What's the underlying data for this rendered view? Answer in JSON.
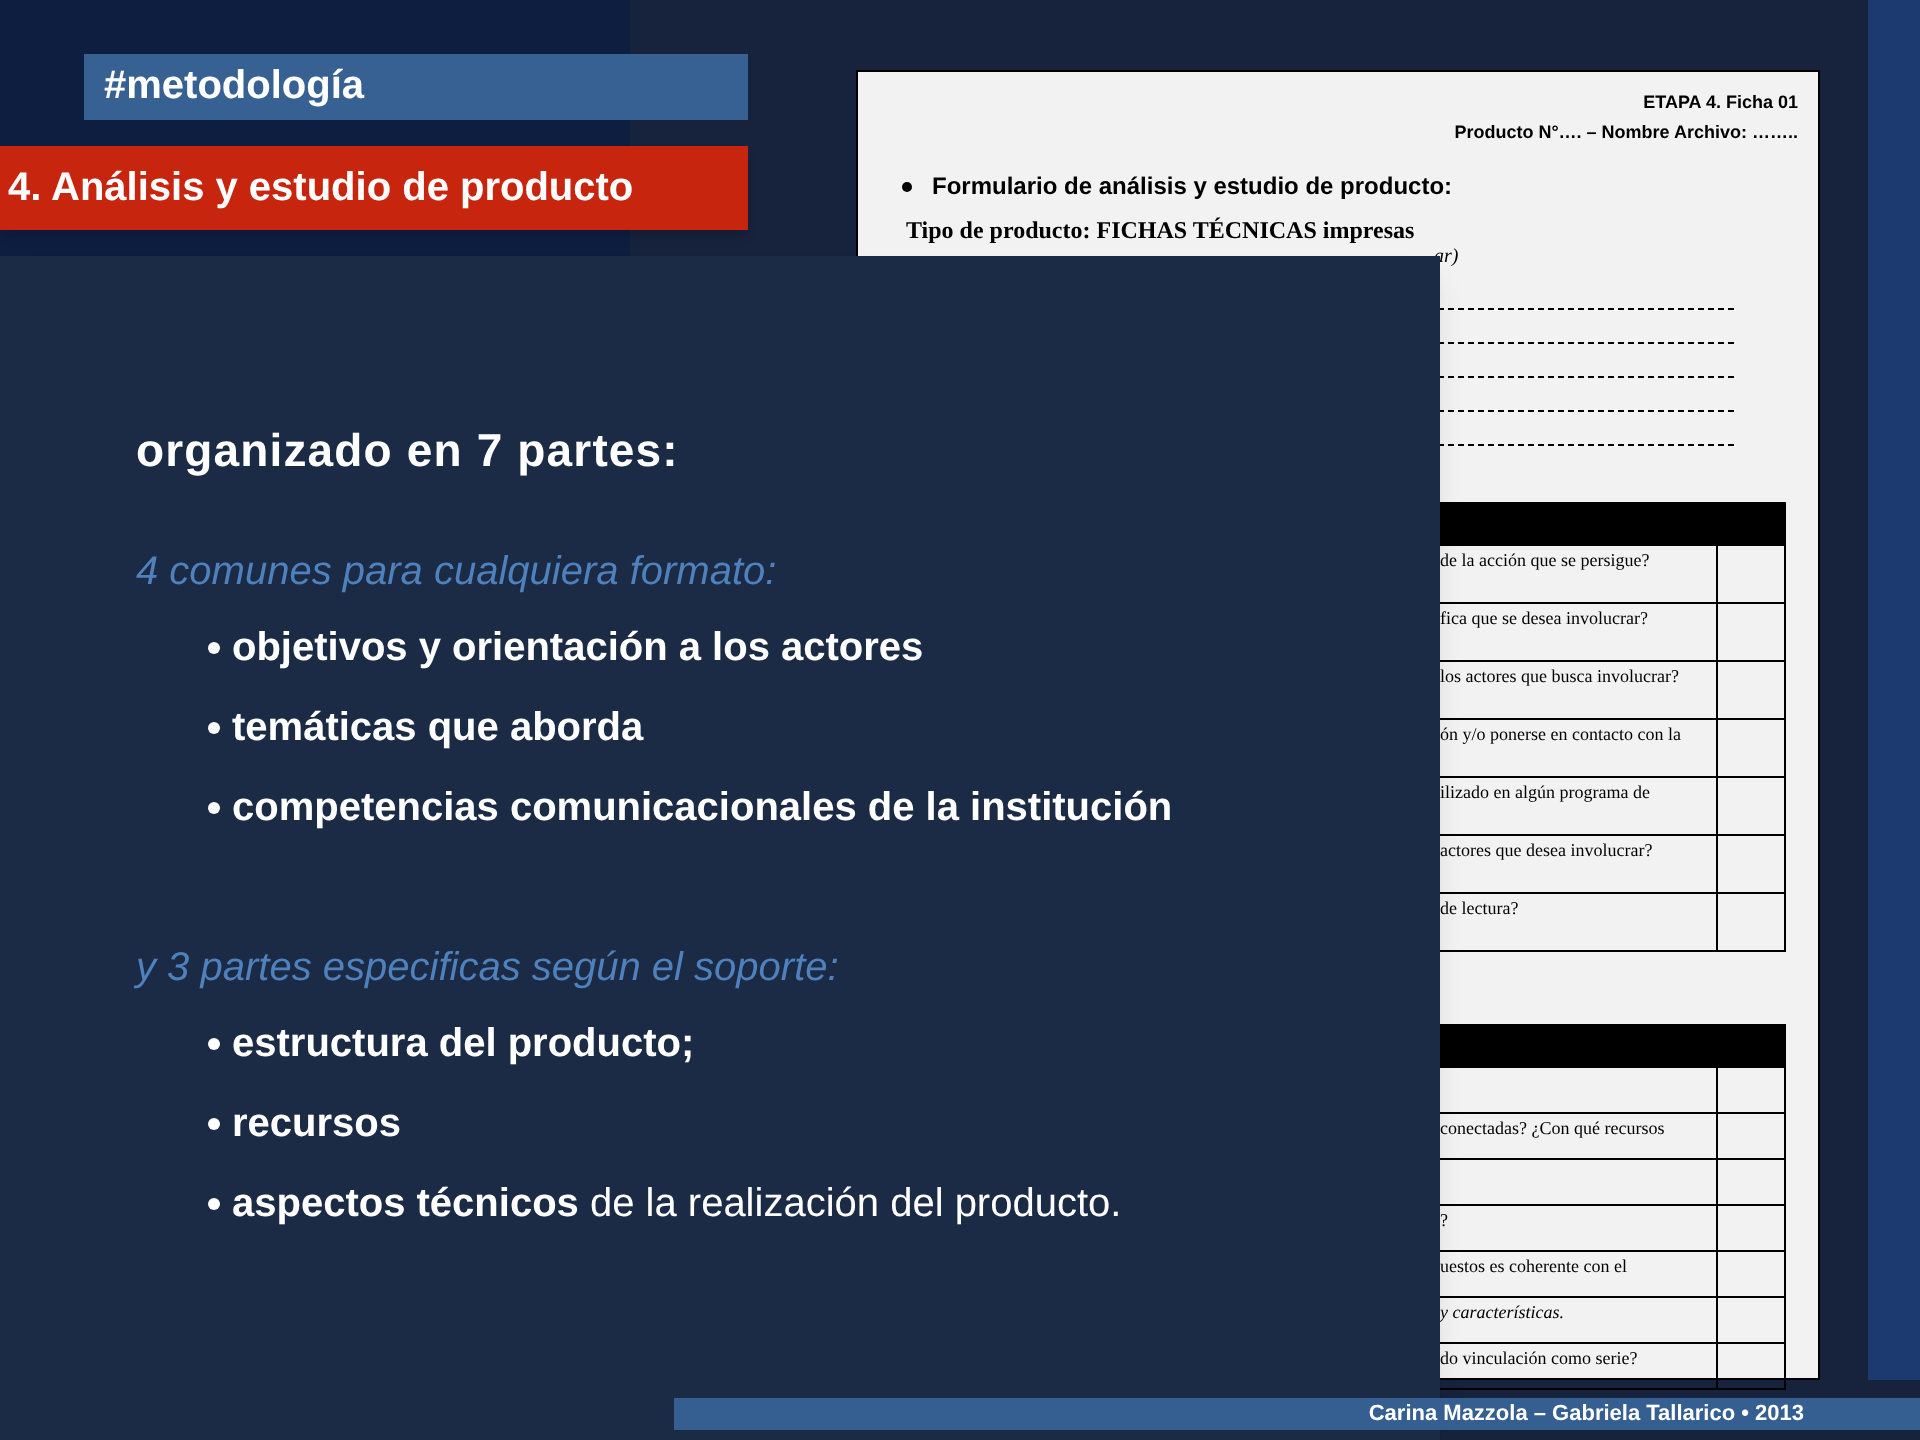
{
  "tags": {
    "section": "#metodología",
    "title": "4. Análisis y estudio de producto"
  },
  "document": {
    "header": [
      "ETAPA 4. Ficha 01",
      "Producto N°…. – Nombre Archivo: …….."
    ],
    "heading": "Formulario de análisis y estudio de producto:",
    "product_type": "Tipo de producto: FICHAS TÉCNICAS impresas",
    "cut_note": "ar)",
    "tables": [
      {
        "rows": [
          {
            "text": "de la acción que se persigue?",
            "italic": false
          },
          {
            "text": "fica que se desea involucrar?",
            "italic": false
          },
          {
            "text": "los actores que busca involucrar?",
            "italic": false
          },
          {
            "text": "ón y/o ponerse en contacto con la",
            "italic": false
          },
          {
            "text": "ilizado en algún programa de",
            "italic": false
          },
          {
            "text": "actores que desea involucrar?",
            "italic": false
          },
          {
            "text": "de lectura?",
            "italic": false
          }
        ]
      },
      {
        "rows": [
          {
            "text": ""
          },
          {
            "text": "conectadas? ¿Con qué recursos",
            "italic": false
          },
          {
            "text": ""
          },
          {
            "text": "?",
            "italic": false
          },
          {
            "text": "uestos es coherente con el",
            "italic": false
          },
          {
            "text": "y características.",
            "italic": true
          },
          {
            "text": "do vinculación como serie?",
            "italic": false
          }
        ]
      }
    ]
  },
  "panel": {
    "heading": "organizado en 7 partes:",
    "groups": [
      {
        "intro": "4 comunes para cualquiera formato:",
        "items": [
          "objetivos y orientación a los actores",
          "temáticas que aborda",
          "competencias comunicacionales de la institución"
        ]
      },
      {
        "intro": "y 3 partes especificas según el soporte:",
        "items": [
          "estructura del producto;",
          "recursos",
          "**aspectos técnicos** de la realización del producto."
        ]
      }
    ]
  },
  "footer": "Carina Mazzola – Gabriela Tallarico • 2013"
}
